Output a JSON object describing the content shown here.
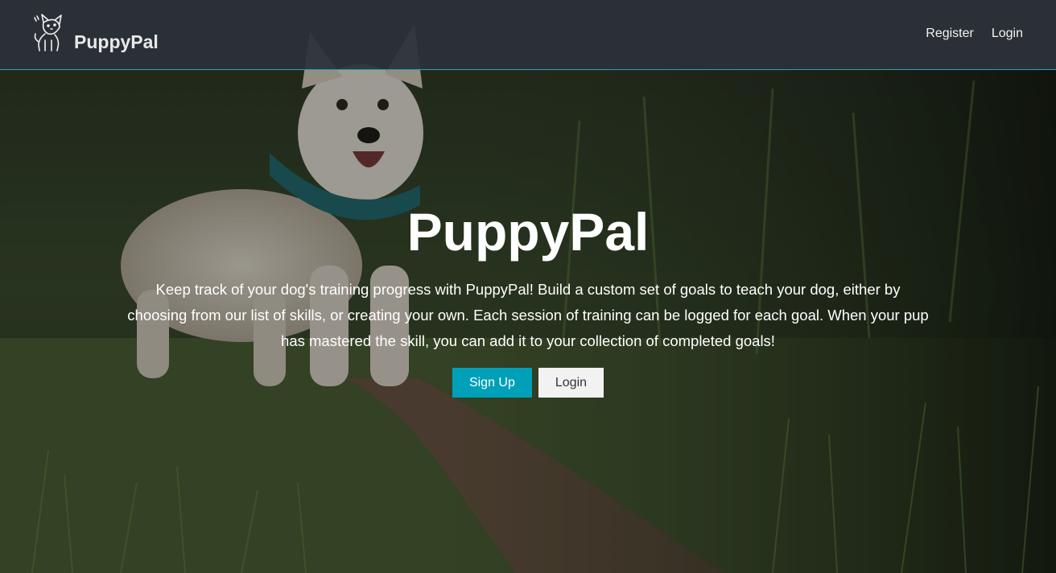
{
  "navbar": {
    "brand_name": "PuppyPal",
    "links": [
      "Register",
      "Login"
    ]
  },
  "hero": {
    "title": "PuppyPal",
    "description": "Keep track of your dog's training progress with PuppyPal! Build a custom set of goals to teach your dog, either by choosing from our list of skills, or creating your own. Each session of training can be logged for each goal. When your pup has mastered the skill, you can add it to your collection of completed goals!",
    "buttons": {
      "signup_label": "Sign Up",
      "login_label": "Login"
    }
  },
  "colors": {
    "navbar_bg": "#2c323a",
    "navbar_border": "#2aa3b4",
    "primary_button": "#00a0b8",
    "secondary_button": "#f2f2f2"
  },
  "icons": {
    "brand_logo": "dog-logo-icon"
  }
}
